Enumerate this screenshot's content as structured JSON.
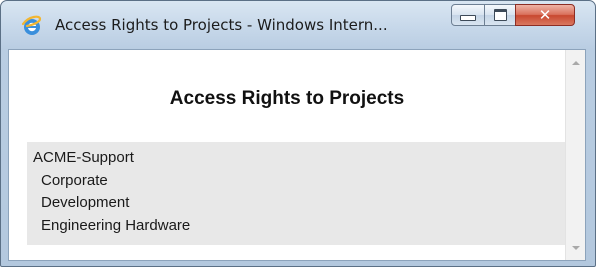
{
  "window": {
    "title": "Access Rights to Projects - Windows Intern..."
  },
  "caption_buttons": {
    "minimize_icon": "minimize-icon",
    "maximize_icon": "maximize-icon",
    "close_glyph": "✕"
  },
  "page": {
    "title": "Access Rights to Projects"
  },
  "projects": [
    {
      "label": "ACME-Support",
      "level": 0
    },
    {
      "label": "Corporate",
      "level": 1
    },
    {
      "label": "Development",
      "level": 1
    },
    {
      "label": "Engineering Hardware",
      "level": 1
    }
  ],
  "colors": {
    "list_background": "#e8e8e8",
    "close_button": "#c8472f",
    "title_bar": "#c7d8ea"
  }
}
